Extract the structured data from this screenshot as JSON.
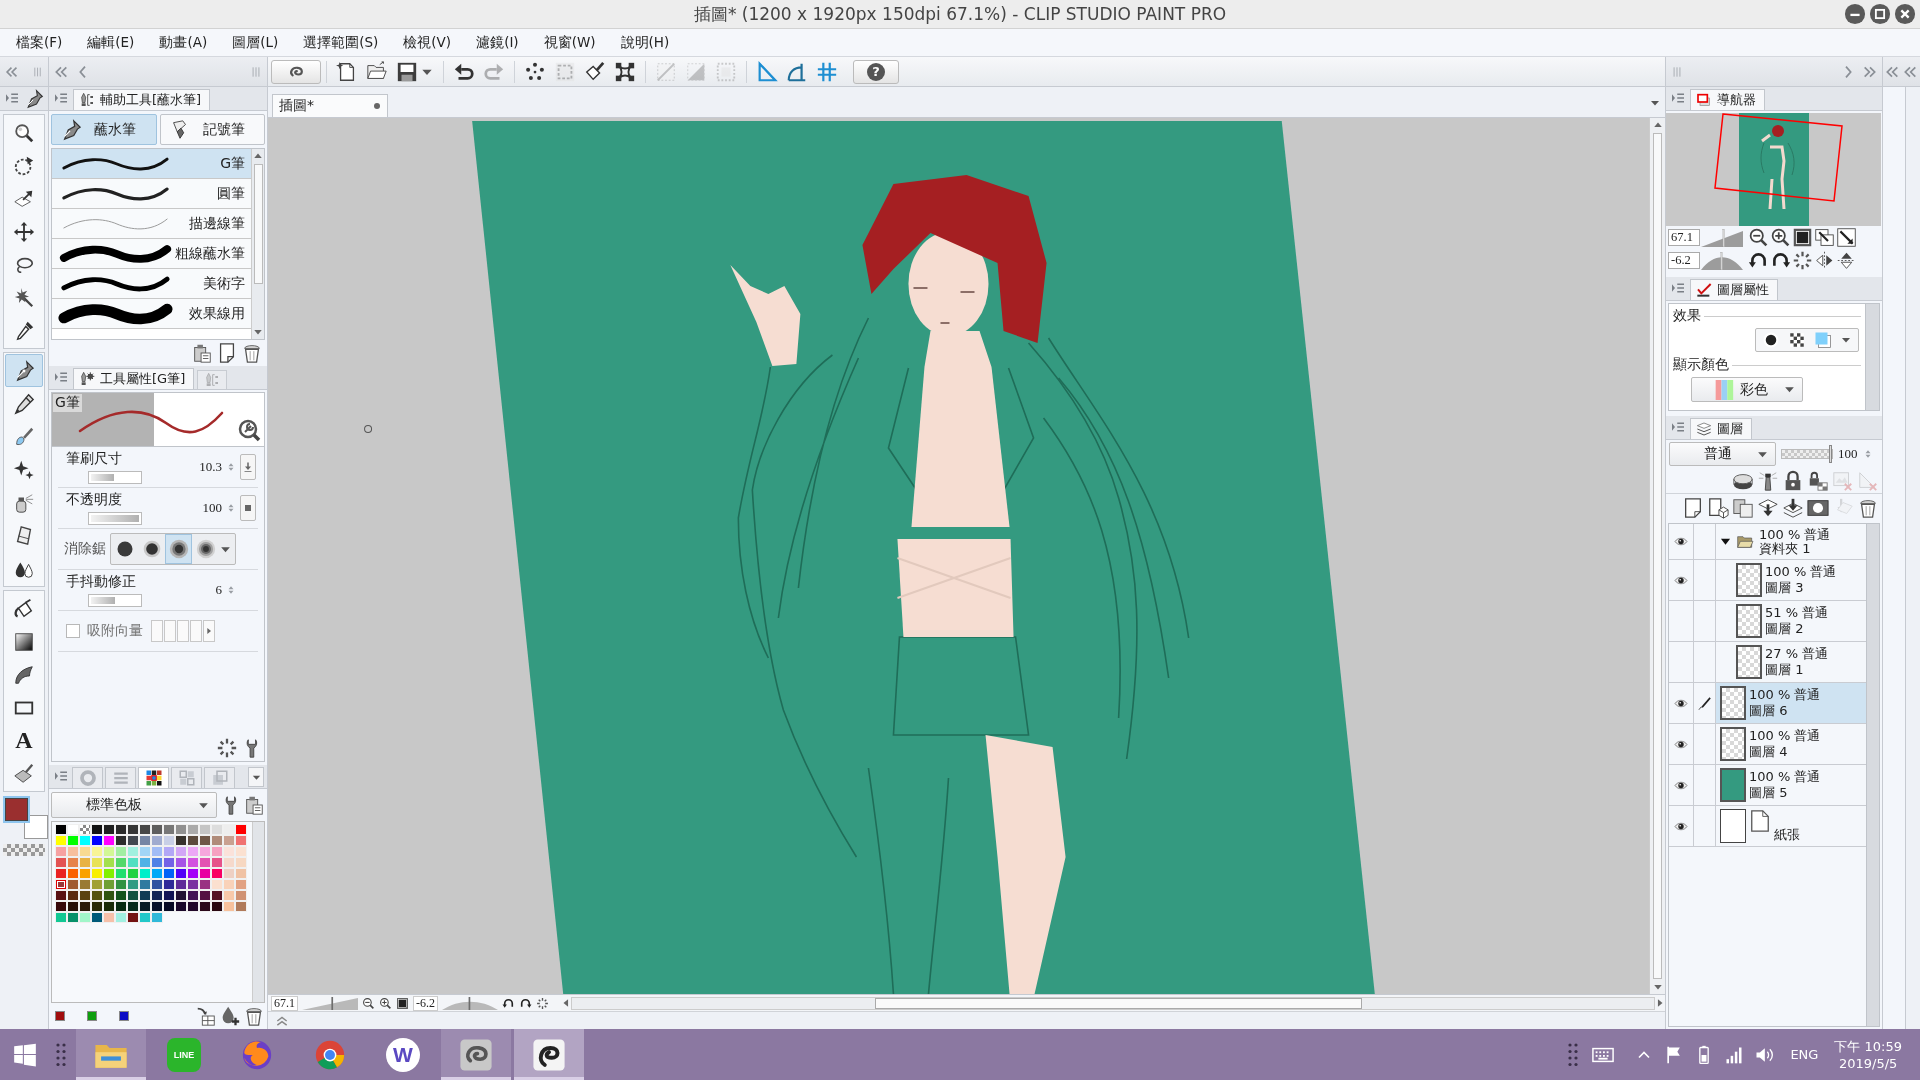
{
  "window": {
    "title": "插圖* (1200 x 1920px 150dpi 67.1%) - CLIP STUDIO PAINT PRO"
  },
  "menu": [
    "檔案(F)",
    "編輯(E)",
    "動畫(A)",
    "圖層(L)",
    "選擇範圍(S)",
    "檢視(V)",
    "濾鏡(I)",
    "視窗(W)",
    "說明(H)"
  ],
  "toolbox": {
    "tool_groups": [
      {
        "tools": [
          {
            "kind": "zoom",
            "selected": false
          },
          {
            "kind": "move",
            "selected": false
          },
          {
            "kind": "operation",
            "selected": false
          },
          {
            "kind": "move_layer",
            "selected": false
          },
          {
            "kind": "lasso",
            "selected": false
          },
          {
            "kind": "magic_wand",
            "selected": false
          },
          {
            "kind": "eyedropper",
            "selected": false
          }
        ]
      },
      {
        "tools": [
          {
            "kind": "pen",
            "selected": true
          },
          {
            "kind": "pencil",
            "selected": false
          },
          {
            "kind": "brush",
            "selected": false
          },
          {
            "kind": "decoration",
            "selected": false
          },
          {
            "kind": "airbrush",
            "selected": false
          },
          {
            "kind": "eraser",
            "selected": false
          },
          {
            "kind": "blend",
            "selected": false
          }
        ]
      },
      {
        "tools": [
          {
            "kind": "fill",
            "selected": false
          },
          {
            "kind": "gradient",
            "selected": false
          },
          {
            "kind": "figure",
            "selected": false
          },
          {
            "kind": "frame",
            "selected": false
          },
          {
            "kind": "text",
            "label": "A",
            "selected": false
          },
          {
            "kind": "correct_line",
            "selected": false
          }
        ]
      }
    ],
    "colors": [
      {
        "kind": "main",
        "color": "#9a2f2f"
      },
      {
        "kind": "sub",
        "color": "#ffffff"
      }
    ]
  },
  "sub_tool": {
    "title": "輔助工具[蘸水筆]",
    "groups": [
      {
        "kind": "dip_pen",
        "label": "蘸水筆",
        "selected": true
      },
      {
        "kind": "marker",
        "label": "記號筆",
        "selected": false
      }
    ],
    "brushes": [
      {
        "kind": "g",
        "name": "G筆",
        "selected": true
      },
      {
        "kind": "round",
        "name": "圓筆",
        "selected": false
      },
      {
        "kind": "outline",
        "name": "描邊線筆",
        "selected": false
      },
      {
        "kind": "thick",
        "name": "粗線蘸水筆",
        "selected": false
      },
      {
        "kind": "art",
        "name": "美術字",
        "selected": false
      },
      {
        "kind": "effect",
        "name": "效果線用",
        "selected": false
      }
    ]
  },
  "tool_property": {
    "title": "工具屬性[G筆]",
    "preview_label": "G筆",
    "settings": [
      {
        "kind": "pressure_slider",
        "label": "筆刷尺寸",
        "value": "10.3",
        "level": 0.47
      },
      {
        "kind": "toggle_slider",
        "label": "不透明度",
        "value": "100",
        "level": 1
      },
      {
        "kind": "options",
        "label": "消除鋸",
        "options": [
          {
            "kind": "none",
            "selected": false
          },
          {
            "kind": "weak",
            "selected": false
          },
          {
            "kind": "medium",
            "selected": true
          },
          {
            "kind": "strong",
            "selected": false
          }
        ]
      },
      {
        "kind": "slider",
        "label": "手抖動修正",
        "value": "6",
        "level": 0.51
      },
      {
        "kind": "checkbox",
        "label": "吸附向量",
        "checked": false,
        "disabled": true
      }
    ]
  },
  "color_panel": {
    "tabs": [
      {
        "kind": "wheel",
        "selected": false
      },
      {
        "kind": "sliders",
        "selected": false
      },
      {
        "kind": "palette",
        "selected": true
      },
      {
        "kind": "set",
        "selected": false
      },
      {
        "kind": "sub_view",
        "selected": false
      }
    ],
    "palette_name": "標準色板",
    "swatches": [
      [
        {
          "kind": "color",
          "color": "#000000",
          "selected": false
        },
        {
          "kind": "color",
          "color": "#ffffff",
          "selected": false
        },
        {
          "kind": "transparent",
          "selected": false
        },
        {
          "kind": "color",
          "color": "#131313",
          "selected": false
        },
        {
          "kind": "color",
          "color": "#1f1f1f",
          "selected": false
        },
        {
          "kind": "color",
          "color": "#2a2a2a",
          "selected": false
        },
        {
          "kind": "color",
          "color": "#363636",
          "selected": false
        },
        {
          "kind": "color",
          "color": "#474747",
          "selected": false
        },
        {
          "kind": "color",
          "color": "#5e5e5e",
          "selected": false
        },
        {
          "kind": "color",
          "color": "#777777",
          "selected": false
        },
        {
          "kind": "color",
          "color": "#909090",
          "selected": false
        },
        {
          "kind": "color",
          "color": "#aaaaaa",
          "selected": false
        },
        {
          "kind": "color",
          "color": "#c5c5c5",
          "selected": false
        },
        {
          "kind": "color",
          "color": "#dddddd",
          "selected": false
        },
        {
          "kind": "color",
          "color": "#eeeeee",
          "selected": false
        },
        {
          "kind": "color",
          "color": "#ff0000",
          "selected": false
        }
      ],
      [
        {
          "kind": "color",
          "color": "#ffff00",
          "selected": false
        },
        {
          "kind": "color",
          "color": "#00ff00",
          "selected": false
        },
        {
          "kind": "color",
          "color": "#00ffff",
          "selected": false
        },
        {
          "kind": "color",
          "color": "#0000ff",
          "selected": false
        },
        {
          "kind": "color",
          "color": "#ff00ff",
          "selected": false
        },
        {
          "kind": "color",
          "color": "#2c2c2c",
          "selected": false
        },
        {
          "kind": "color",
          "color": "#42474f",
          "selected": false
        },
        {
          "kind": "color",
          "color": "#7686a5",
          "selected": false
        },
        {
          "kind": "color",
          "color": "#a0abcf",
          "selected": false
        },
        {
          "kind": "color",
          "color": "#c8cfe6",
          "selected": false
        },
        {
          "kind": "color",
          "color": "#37322c",
          "selected": false
        },
        {
          "kind": "color",
          "color": "#5b4a3c",
          "selected": false
        },
        {
          "kind": "color",
          "color": "#6f5747",
          "selected": false
        },
        {
          "kind": "color",
          "color": "#b08b79",
          "selected": false
        },
        {
          "kind": "color",
          "color": "#c9a191",
          "selected": false
        },
        {
          "kind": "color",
          "color": "#f07272",
          "selected": false
        }
      ],
      [
        {
          "kind": "color",
          "color": "#f6a2a2",
          "selected": false
        },
        {
          "kind": "color",
          "color": "#f7bf9d",
          "selected": false
        },
        {
          "kind": "color",
          "color": "#f8da92",
          "selected": false
        },
        {
          "kind": "color",
          "color": "#f8f495",
          "selected": false
        },
        {
          "kind": "color",
          "color": "#d2f795",
          "selected": false
        },
        {
          "kind": "color",
          "color": "#a2eea2",
          "selected": false
        },
        {
          "kind": "color",
          "color": "#a0f0df",
          "selected": false
        },
        {
          "kind": "color",
          "color": "#a2d5f6",
          "selected": false
        },
        {
          "kind": "color",
          "color": "#a1bcf6",
          "selected": false
        },
        {
          "kind": "color",
          "color": "#b2a7f6",
          "selected": false
        },
        {
          "kind": "color",
          "color": "#d2a6f6",
          "selected": false
        },
        {
          "kind": "color",
          "color": "#eca7f6",
          "selected": false
        },
        {
          "kind": "color",
          "color": "#f6a6dd",
          "selected": false
        },
        {
          "kind": "color",
          "color": "#f6a1c0",
          "selected": false
        },
        {
          "kind": "color",
          "color": "#fbe2da",
          "selected": false
        },
        {
          "kind": "color",
          "color": "#fbe1d1",
          "selected": false
        }
      ],
      [
        {
          "kind": "color",
          "color": "#e35353",
          "selected": false
        },
        {
          "kind": "color",
          "color": "#e6834b",
          "selected": false
        },
        {
          "kind": "color",
          "color": "#e8b244",
          "selected": false
        },
        {
          "kind": "color",
          "color": "#e8e256",
          "selected": false
        },
        {
          "kind": "color",
          "color": "#a3e04c",
          "selected": false
        },
        {
          "kind": "color",
          "color": "#53d86a",
          "selected": false
        },
        {
          "kind": "color",
          "color": "#52dfc1",
          "selected": false
        },
        {
          "kind": "color",
          "color": "#4fb2e6",
          "selected": false
        },
        {
          "kind": "color",
          "color": "#4f82e6",
          "selected": false
        },
        {
          "kind": "color",
          "color": "#7362e6",
          "selected": false
        },
        {
          "kind": "color",
          "color": "#a753e6",
          "selected": false
        },
        {
          "kind": "color",
          "color": "#d252df",
          "selected": false
        },
        {
          "kind": "color",
          "color": "#e352b2",
          "selected": false
        },
        {
          "kind": "color",
          "color": "#e65389",
          "selected": false
        },
        {
          "kind": "color",
          "color": "#f6d9cb",
          "selected": false
        },
        {
          "kind": "color",
          "color": "#f7d8c2",
          "selected": false
        }
      ],
      [
        {
          "kind": "color",
          "color": "#ea2222",
          "selected": false
        },
        {
          "kind": "color",
          "color": "#fa6100",
          "selected": false
        },
        {
          "kind": "color",
          "color": "#faa100",
          "selected": false
        },
        {
          "kind": "color",
          "color": "#f8ef00",
          "selected": false
        },
        {
          "kind": "color",
          "color": "#82f000",
          "selected": false
        },
        {
          "kind": "color",
          "color": "#22df6e",
          "selected": false
        },
        {
          "kind": "color",
          "color": "#22d242",
          "selected": false
        },
        {
          "kind": "color",
          "color": "#00efc9",
          "selected": false
        },
        {
          "kind": "color",
          "color": "#00aaf7",
          "selected": false
        },
        {
          "kind": "color",
          "color": "#0063f7",
          "selected": false
        },
        {
          "kind": "color",
          "color": "#5200f7",
          "selected": false
        },
        {
          "kind": "color",
          "color": "#a400f7",
          "selected": false
        },
        {
          "kind": "color",
          "color": "#e800a2",
          "selected": false
        },
        {
          "kind": "color",
          "color": "#f90062",
          "selected": false
        },
        {
          "kind": "color",
          "color": "#eed0c3",
          "selected": false
        },
        {
          "kind": "color",
          "color": "#f0c2a4",
          "selected": false
        }
      ],
      [
        {
          "kind": "color",
          "color": "#983838",
          "selected": true
        },
        {
          "kind": "color",
          "color": "#a05a31",
          "selected": false
        },
        {
          "kind": "color",
          "color": "#9a7a33",
          "selected": false
        },
        {
          "kind": "color",
          "color": "#a0a034",
          "selected": false
        },
        {
          "kind": "color",
          "color": "#6e9f33",
          "selected": false
        },
        {
          "kind": "color",
          "color": "#319142",
          "selected": false
        },
        {
          "kind": "color",
          "color": "#319a82",
          "selected": false
        },
        {
          "kind": "color",
          "color": "#2f7aa0",
          "selected": false
        },
        {
          "kind": "color",
          "color": "#2f51a0",
          "selected": false
        },
        {
          "kind": "color",
          "color": "#2f2a98",
          "selected": false
        },
        {
          "kind": "color",
          "color": "#5f2a98",
          "selected": false
        },
        {
          "kind": "color",
          "color": "#7a31a0",
          "selected": false
        },
        {
          "kind": "color",
          "color": "#9a3282",
          "selected": false
        },
        {
          "kind": "color",
          "color": "#fbe0cf",
          "selected": false
        },
        {
          "kind": "color",
          "color": "#f9d2b9",
          "selected": false
        },
        {
          "kind": "color",
          "color": "#e2a283",
          "selected": false
        }
      ],
      [
        {
          "kind": "color",
          "color": "#5a1111",
          "selected": false
        },
        {
          "kind": "color",
          "color": "#5b2a10",
          "selected": false
        },
        {
          "kind": "color",
          "color": "#5a4210",
          "selected": false
        },
        {
          "kind": "color",
          "color": "#545310",
          "selected": false
        },
        {
          "kind": "color",
          "color": "#2f5410",
          "selected": false
        },
        {
          "kind": "color",
          "color": "#11531b",
          "selected": false
        },
        {
          "kind": "color",
          "color": "#115240",
          "selected": false
        },
        {
          "kind": "color",
          "color": "#113b54",
          "selected": false
        },
        {
          "kind": "color",
          "color": "#112354",
          "selected": false
        },
        {
          "kind": "color",
          "color": "#111354",
          "selected": false
        },
        {
          "kind": "color",
          "color": "#221133",
          "selected": false
        },
        {
          "kind": "color",
          "color": "#421154",
          "selected": false
        },
        {
          "kind": "color",
          "color": "#541143",
          "selected": false
        },
        {
          "kind": "color",
          "color": "#541123",
          "selected": false
        },
        {
          "kind": "color",
          "color": "#f8c9aa",
          "selected": false
        },
        {
          "kind": "color",
          "color": "#d09273",
          "selected": false
        }
      ],
      [
        {
          "kind": "color",
          "color": "#380909",
          "selected": false
        },
        {
          "kind": "color",
          "color": "#281108",
          "selected": false
        },
        {
          "kind": "color",
          "color": "#2a1a08",
          "selected": false
        },
        {
          "kind": "color",
          "color": "#2a2a08",
          "selected": false
        },
        {
          "kind": "color",
          "color": "#1a2a08",
          "selected": false
        },
        {
          "kind": "color",
          "color": "#082a11",
          "selected": false
        },
        {
          "kind": "color",
          "color": "#082a1b",
          "selected": false
        },
        {
          "kind": "color",
          "color": "#081b24",
          "selected": false
        },
        {
          "kind": "color",
          "color": "#08122a",
          "selected": false
        },
        {
          "kind": "color",
          "color": "#080a24",
          "selected": false
        },
        {
          "kind": "color",
          "color": "#1a082a",
          "selected": false
        },
        {
          "kind": "color",
          "color": "#22082a",
          "selected": false
        },
        {
          "kind": "color",
          "color": "#2a081a",
          "selected": false
        },
        {
          "kind": "color",
          "color": "#2a0811",
          "selected": false
        },
        {
          "kind": "color",
          "color": "#f7c19c",
          "selected": false
        },
        {
          "kind": "color",
          "color": "#b07a5a",
          "selected": false
        }
      ],
      [
        {
          "kind": "color",
          "color": "#12c893",
          "selected": false
        },
        {
          "kind": "color",
          "color": "#08916a",
          "selected": false
        },
        {
          "kind": "color",
          "color": "#a1f6c9",
          "selected": false
        },
        {
          "kind": "color",
          "color": "#005a79",
          "selected": false
        },
        {
          "kind": "color",
          "color": "#f6c0a9",
          "selected": false
        },
        {
          "kind": "color",
          "color": "#a1f0e1",
          "selected": false
        },
        {
          "kind": "color",
          "color": "#731212",
          "selected": false
        },
        {
          "kind": "color",
          "color": "#22c8c9",
          "selected": false
        },
        {
          "kind": "color",
          "color": "#30b9d9",
          "selected": false
        }
      ]
    ],
    "custom_colors": [
      {
        "color": "#a00d0d"
      },
      {
        "color": "#0e9e0e"
      },
      {
        "color": "#0c0cc4"
      }
    ]
  },
  "command_bar": {
    "groups": [
      {
        "items": [
          {
            "kind": "new",
            "disabled": false
          },
          {
            "kind": "open",
            "disabled": false
          },
          {
            "kind": "save",
            "disabled": false
          },
          {
            "kind": "save_menu",
            "disabled": false
          }
        ]
      },
      {
        "items": [
          {
            "kind": "undo",
            "disabled": false
          },
          {
            "kind": "redo",
            "disabled": true
          }
        ]
      },
      {
        "items": [
          {
            "kind": "dots",
            "disabled": false
          },
          {
            "kind": "select_box",
            "disabled": true
          },
          {
            "kind": "fill_select",
            "disabled": false
          },
          {
            "kind": "transform",
            "disabled": false
          }
        ]
      },
      {
        "items": [
          {
            "kind": "ruler_diag",
            "disabled": true
          },
          {
            "kind": "ruler_tri",
            "disabled": true
          },
          {
            "kind": "ruler_dots",
            "disabled": true
          }
        ]
      },
      {
        "items": [
          {
            "kind": "ruler_line",
            "disabled": false
          },
          {
            "kind": "ruler_curve",
            "disabled": false
          },
          {
            "kind": "ruler_grid",
            "disabled": false
          }
        ]
      }
    ],
    "help_label": "?"
  },
  "document": {
    "tab": "插圖*"
  },
  "status_bar": {
    "zoom": {
      "value": "67.1",
      "level": 0.54
    },
    "rotation": {
      "value": "-6.2",
      "level": 0.49
    }
  },
  "navigator": {
    "title": "導航器",
    "zoom": {
      "value": "67.1",
      "level": 0.54
    },
    "rotation": {
      "value": "-6.2",
      "level": 0.49
    }
  },
  "layer_property": {
    "title": "圖層屬性",
    "effect_label": "效果",
    "display_color_label": "顯示顏色",
    "display_color": "彩色"
  },
  "layers_panel": {
    "title": "圖層",
    "blend_mode": "普通",
    "opacity": {
      "value": "100",
      "level": 1
    },
    "tool_rows": [
      {
        "items": [
          {
            "kind": "clip",
            "disabled": false
          },
          {
            "kind": "reference",
            "disabled": false
          },
          {
            "kind": "lock",
            "disabled": false
          },
          {
            "kind": "lock_alpha",
            "disabled": false
          },
          {
            "kind": "mask_show",
            "disabled": true
          },
          {
            "kind": "ruler_show",
            "disabled": true
          }
        ]
      },
      {
        "items": [
          {
            "kind": "new_raster",
            "disabled": false
          },
          {
            "kind": "new_vector",
            "disabled": false
          },
          {
            "kind": "new_folder",
            "disabled": false
          },
          {
            "kind": "transfer_down",
            "disabled": false
          },
          {
            "kind": "merge_down",
            "disabled": false
          },
          {
            "kind": "mask",
            "disabled": false
          },
          {
            "kind": "transfer",
            "disabled": true
          },
          {
            "kind": "delete",
            "disabled": false
          }
        ]
      }
    ],
    "layers": [
      {
        "kind": "folder",
        "mode": "100 % 普通",
        "name": "資料夾 1",
        "visible": true,
        "selected": false,
        "expanded": true,
        "children": [
          {
            "kind": "raster",
            "mode": "100 % 普通",
            "name": "圖層 3",
            "visible": true,
            "selected": false
          },
          {
            "kind": "raster",
            "mode": "51 % 普通",
            "name": "圖層 2",
            "visible": false,
            "selected": false
          },
          {
            "kind": "raster",
            "mode": "27 % 普通",
            "name": "圖層 1",
            "visible": false,
            "selected": false
          }
        ]
      },
      {
        "kind": "raster",
        "mode": "100 % 普通",
        "name": "圖層 6",
        "visible": true,
        "selected": true
      },
      {
        "kind": "raster",
        "mode": "100 % 普通",
        "name": "圖層 4",
        "visible": true,
        "selected": false
      },
      {
        "kind": "fill",
        "mode": "100 % 普通",
        "name": "圖層 5",
        "visible": true,
        "selected": false
      },
      {
        "kind": "paper",
        "name": "紙張",
        "visible": true,
        "selected": false
      }
    ]
  },
  "taskbar": {
    "apps": [
      {
        "kind": "explorer",
        "running": true,
        "selected": false
      },
      {
        "kind": "line",
        "label": "LINE",
        "running": false,
        "selected": false
      },
      {
        "kind": "firefox",
        "running": false,
        "selected": false
      },
      {
        "kind": "chrome",
        "running": false,
        "selected": false
      },
      {
        "kind": "w",
        "label": "W",
        "running": false,
        "selected": false
      },
      {
        "kind": "swirl",
        "running": true,
        "selected": false
      },
      {
        "kind": "swirl_dark",
        "running": true,
        "selected": true
      }
    ],
    "language": "ENG",
    "time": "下午 10:59",
    "date": "2019/5/5"
  }
}
